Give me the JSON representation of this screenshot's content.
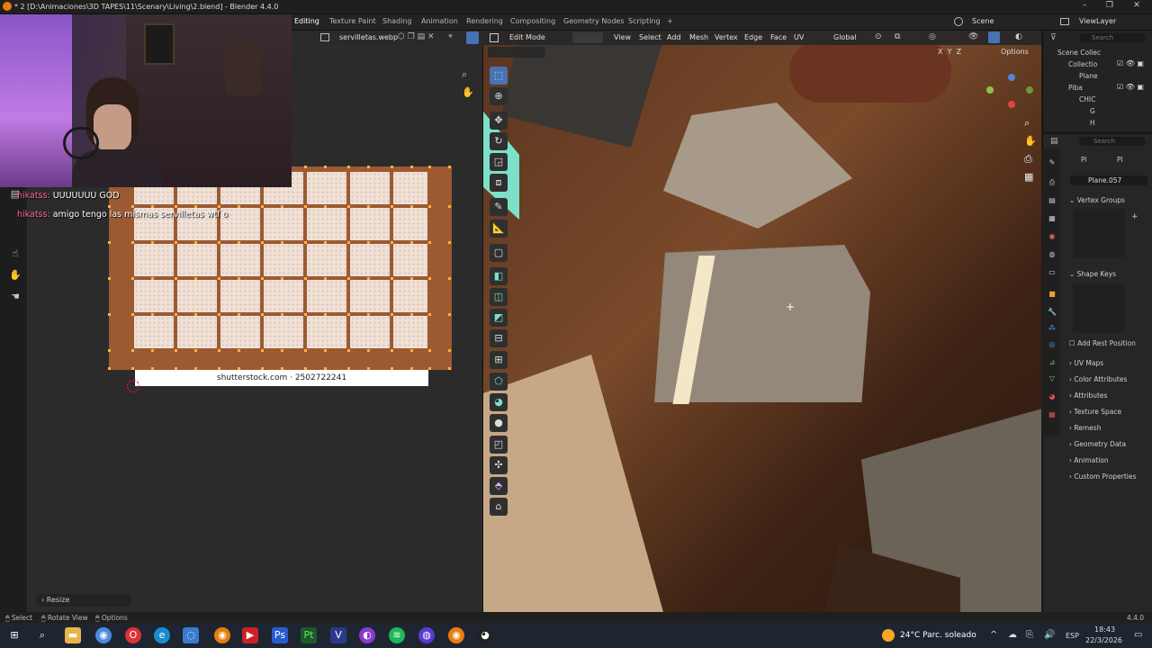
{
  "window": {
    "title": "* 2 [D:\\Animaciones\\3D TAPES\\11\\Scenary\\Living\\2.blend] - Blender 4.4.0",
    "controls": [
      "–",
      "❐",
      "✕"
    ]
  },
  "workspace_tabs": [
    "Editing",
    "Texture Paint",
    "Shading",
    "Animation",
    "Rendering",
    "Compositing",
    "Geometry Nodes",
    "Scripting",
    "+"
  ],
  "active_workspace": "Editing",
  "scene": {
    "name": "Scene",
    "view_layer": "ViewLayer"
  },
  "uv_editor": {
    "image_name": "servilletas.webp",
    "watermark": "shutterstock.com · 2502722241",
    "last_operation": "Resize"
  },
  "chat": [
    {
      "user": "hikatss:",
      "message": "UUUUUUU GOD"
    },
    {
      "user": "hikatss:",
      "message": "amigo tengo las mismas servilletas wtf o"
    }
  ],
  "viewport": {
    "mode": "Edit Mode",
    "menus": [
      "View",
      "Select",
      "Add",
      "Mesh",
      "Vertex",
      "Edge",
      "Face",
      "UV"
    ],
    "transform_orientation": "Global",
    "options_label": "Options",
    "axes": [
      "X",
      "Y",
      "Z"
    ]
  },
  "outliner": {
    "search_placeholder": "Search",
    "rows": [
      "Scene Collec",
      "Collectio",
      "Plane",
      "Piba",
      "CHIC",
      "G",
      "H"
    ]
  },
  "properties": {
    "search_placeholder": "Search",
    "breadcrumb": [
      "Pl",
      "Pl"
    ],
    "object_name": "Plane.057",
    "panels": [
      "Vertex Groups",
      "Shape Keys",
      "UV Maps",
      "Color Attributes",
      "Attributes",
      "Texture Space",
      "Remesh",
      "Geometry Data",
      "Animation",
      "Custom Properties"
    ],
    "add_rest_position": "Add Rest Position"
  },
  "statusbar": {
    "items": [
      "Select",
      "Rotate View",
      "Options"
    ],
    "version": "4.4.0"
  },
  "taskbar": {
    "weather": "24°C  Parc. soleado",
    "language": "ESP",
    "time": "18:43",
    "date": "22/3/2026"
  },
  "colors": {
    "accent": "#4772b3",
    "vertex": "#ffb23c",
    "image_border": "#9b5a32"
  }
}
